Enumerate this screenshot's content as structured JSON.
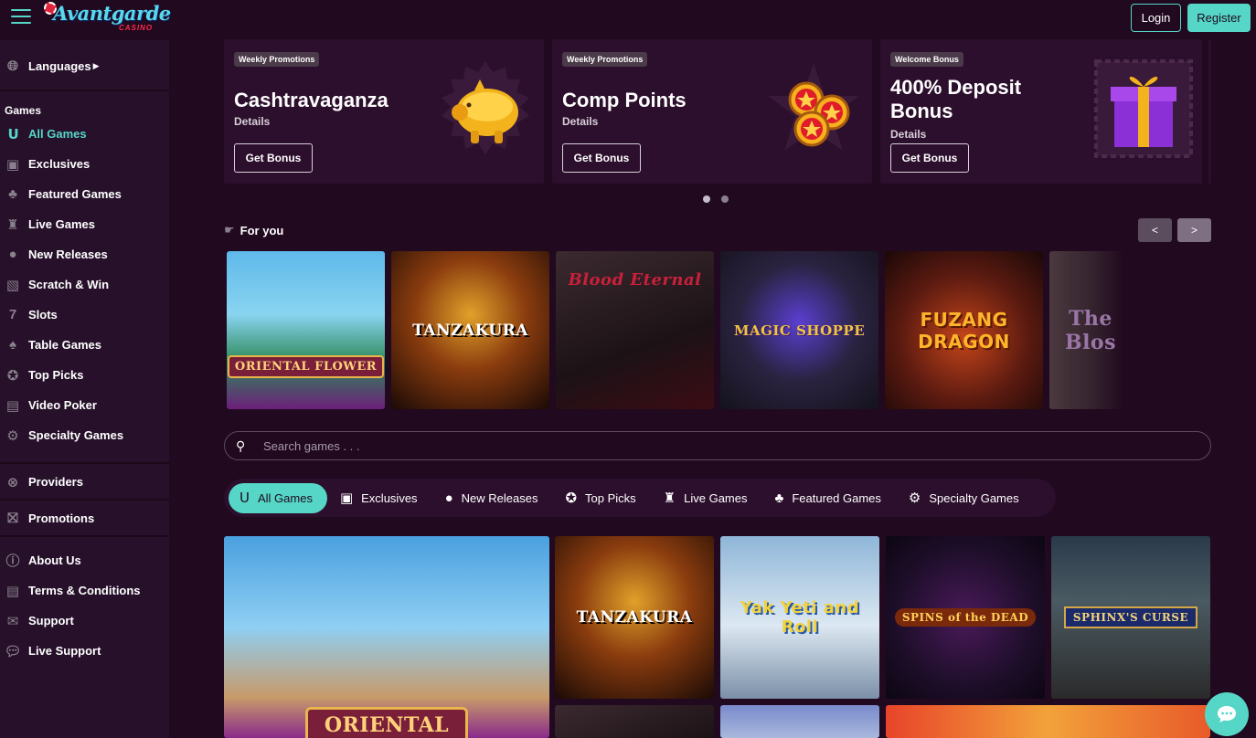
{
  "header": {
    "brand": "Avantgarde",
    "brand_sub": "CASINO",
    "login": "Login",
    "register": "Register"
  },
  "sidebar": {
    "languages": "Languages",
    "games_heading": "Games",
    "games": [
      {
        "label": "All Games",
        "icon": "horseshoe-icon",
        "active": true
      },
      {
        "label": "Exclusives",
        "icon": "exclusive-icon"
      },
      {
        "label": "Featured Games",
        "icon": "clover-icon"
      },
      {
        "label": "Live Games",
        "icon": "live-dealer-icon"
      },
      {
        "label": "New Releases",
        "icon": "new-icon"
      },
      {
        "label": "Scratch & Win",
        "icon": "scratch-card-icon"
      },
      {
        "label": "Slots",
        "icon": "seven-icon"
      },
      {
        "label": "Table Games",
        "icon": "card-icon"
      },
      {
        "label": "Top Picks",
        "icon": "medal-icon"
      },
      {
        "label": "Video Poker",
        "icon": "poker-machine-icon"
      },
      {
        "label": "Specialty Games",
        "icon": "gear-icon"
      }
    ],
    "providers": "Providers",
    "promotions": "Promotions",
    "info": [
      {
        "label": "About Us",
        "icon": "info-icon"
      },
      {
        "label": "Terms & Conditions",
        "icon": "document-icon"
      },
      {
        "label": "Support",
        "icon": "mail-icon"
      },
      {
        "label": "Live Support",
        "icon": "chat-icon"
      }
    ]
  },
  "promos": [
    {
      "tag": "Weekly Promotions",
      "title": "Cashtravaganza",
      "details": "Details",
      "button": "Get Bonus",
      "art": "piggy-bank-icon"
    },
    {
      "tag": "Weekly Promotions",
      "title": "Comp Points",
      "details": "Details",
      "button": "Get Bonus",
      "art": "star-coins-icon"
    },
    {
      "tag": "Welcome Bonus",
      "title": "400% Deposit Bonus",
      "details": "Details",
      "button": "Get Bonus",
      "art": "gift-box-icon"
    }
  ],
  "for_you": {
    "title": "For you",
    "prev": "<",
    "next": ">",
    "games": [
      "ORIENTAL FLOWER",
      "TANZAKURA",
      "Blood Eternal",
      "MAGIC SHOPPE",
      "FUZANG DRAGON",
      "The Blos"
    ]
  },
  "search": {
    "placeholder": "Search games . . ."
  },
  "tabs": [
    {
      "label": "All Games",
      "icon": "horseshoe-icon",
      "active": true
    },
    {
      "label": "Exclusives",
      "icon": "exclusive-icon"
    },
    {
      "label": "New Releases",
      "icon": "new-icon"
    },
    {
      "label": "Top Picks",
      "icon": "medal-icon"
    },
    {
      "label": "Live Games",
      "icon": "live-dealer-icon"
    },
    {
      "label": "Featured Games",
      "icon": "clover-icon"
    },
    {
      "label": "Specialty Games",
      "icon": "gear-icon"
    }
  ],
  "grid_games": [
    "ORIENTAL",
    "TANZAKURA",
    "Yak Yeti and Roll",
    "SPINS of the DEAD",
    "SPHINX'S CURSE"
  ],
  "colors": {
    "accent": "#55d6c6",
    "background": "#21091f",
    "card": "#2c0f2c"
  }
}
